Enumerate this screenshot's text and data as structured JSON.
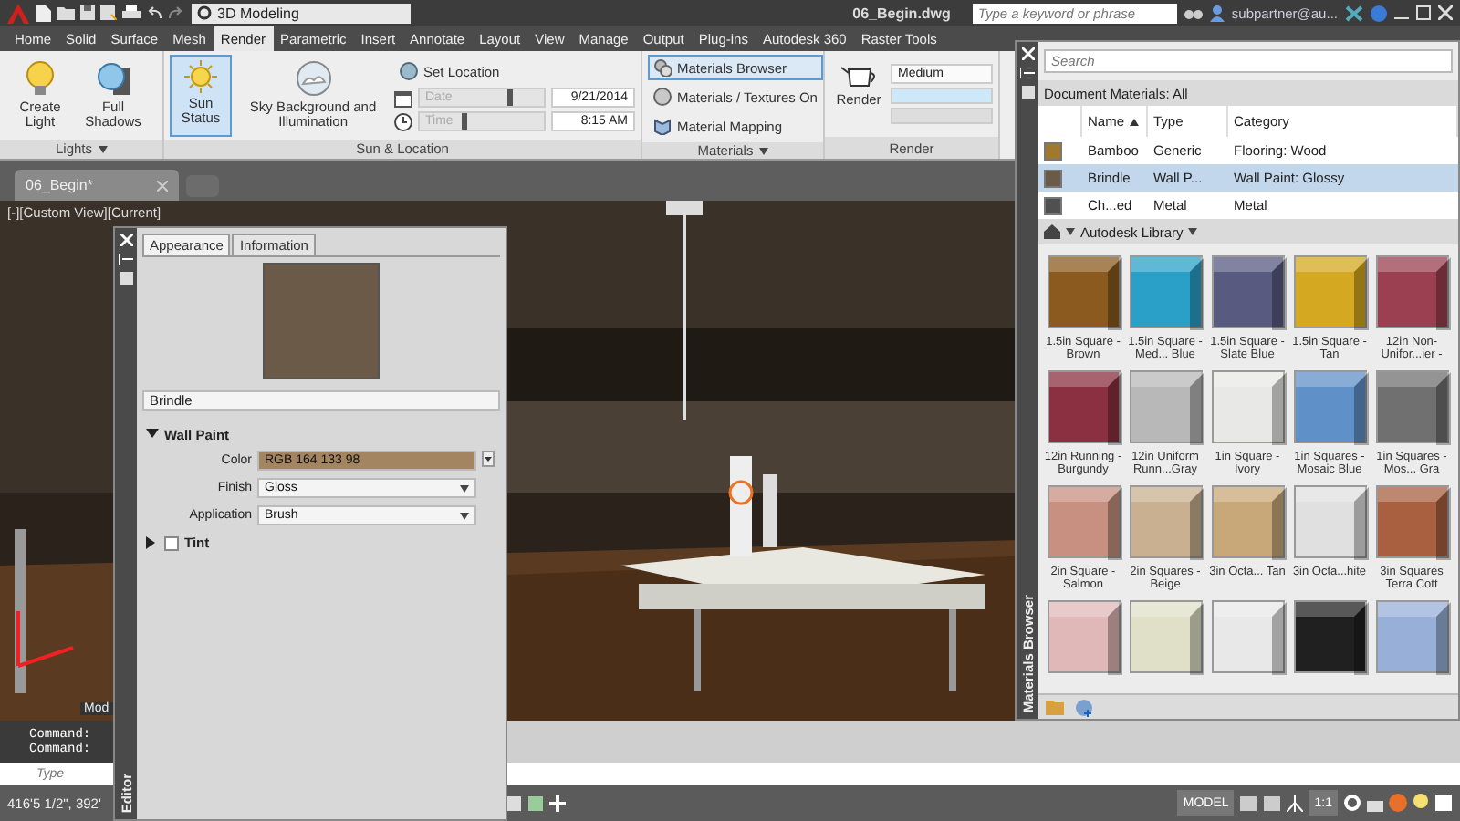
{
  "title_bar": {
    "workspace": "3D Modeling",
    "document_title": "06_Begin.dwg",
    "search": {
      "placeholder": "Type a keyword or phrase"
    },
    "user": "subpartner@au..."
  },
  "ribbon_tabs": [
    {
      "label": "Home",
      "selected": false
    },
    {
      "label": "Solid",
      "selected": false
    },
    {
      "label": "Surface",
      "selected": false
    },
    {
      "label": "Mesh",
      "selected": false
    },
    {
      "label": "Render",
      "selected": true
    },
    {
      "label": "Parametric",
      "selected": false
    },
    {
      "label": "Insert",
      "selected": false
    },
    {
      "label": "Annotate",
      "selected": false
    },
    {
      "label": "Layout",
      "selected": false
    },
    {
      "label": "View",
      "selected": false
    },
    {
      "label": "Manage",
      "selected": false
    },
    {
      "label": "Output",
      "selected": false
    },
    {
      "label": "Plug-ins",
      "selected": false
    },
    {
      "label": "Autodesk 360",
      "selected": false
    },
    {
      "label": "Raster Tools",
      "selected": false
    }
  ],
  "ribbon": {
    "lights": {
      "title": "Lights",
      "buttons": [
        {
          "label": "Create Light",
          "kind": "light"
        },
        {
          "label": "Full Shadows",
          "kind": "shadows"
        }
      ]
    },
    "sun_location": {
      "title": "Sun & Location",
      "sun_status": {
        "label": "Sun Status",
        "on": true
      },
      "sky": {
        "label": "Sky Background and Illumination"
      },
      "set_location": "Set Location",
      "sliders": [
        {
          "kind": "date",
          "label": "Date",
          "level": 0.72,
          "value": "9/21/2014"
        },
        {
          "kind": "time",
          "label": "Time",
          "level": 0.35,
          "value": "8:15 AM"
        }
      ]
    },
    "materials": {
      "title": "Materials",
      "buttons": [
        {
          "label": "Materials Browser",
          "kind": "browser",
          "on": true
        },
        {
          "label": "Materials / Textures On",
          "kind": "textures",
          "on": false
        },
        {
          "label": "Material Mapping",
          "kind": "mapping",
          "on": false
        }
      ]
    },
    "render": {
      "title": "Render",
      "button": "Render",
      "preset": "Medium"
    }
  },
  "file_tabs": [
    {
      "label": "06_Begin*",
      "selected": true
    }
  ],
  "viewport": {
    "label": "[-][Custom View][Current]",
    "layout_tab": "Mod"
  },
  "materials_editor": {
    "title": "Editor",
    "tabs": [
      {
        "label": "Appearance",
        "selected": true
      },
      {
        "label": "Information",
        "selected": false
      }
    ],
    "name": "Brindle",
    "sections": [
      {
        "title": "Wall Paint",
        "expanded": true,
        "kind": "group",
        "properties": [
          {
            "label": "Color",
            "kind": "color",
            "value": "RGB 164 133 98",
            "color": "#a48562"
          },
          {
            "label": "Finish",
            "kind": "dropdown",
            "value": "Gloss"
          },
          {
            "label": "Application",
            "kind": "dropdown",
            "value": "Brush"
          }
        ]
      },
      {
        "title": "Tint",
        "expanded": false,
        "kind": "toggle",
        "checked": false
      }
    ]
  },
  "materials_browser": {
    "title": "Materials Browser",
    "search": {
      "placeholder": "Search"
    },
    "filter": "Document Materials: All",
    "columns": [
      {
        "label": "Name",
        "sorted": true
      },
      {
        "label": "Type",
        "sorted": false
      },
      {
        "label": "Category",
        "sorted": false
      }
    ],
    "rows": [
      {
        "name": "Bamboo",
        "type": "Generic",
        "category": "Flooring: Wood",
        "color": "#a07830",
        "selected": false
      },
      {
        "name": "Brindle",
        "type": "Wall P...",
        "category": "Wall Paint: Glossy",
        "color": "#6a5a48",
        "selected": true
      },
      {
        "name": "Ch...ed",
        "type": "Metal",
        "category": "Metal",
        "color": "#505050",
        "selected": false
      }
    ],
    "library": "Autodesk Library",
    "swatches": [
      {
        "label": "1.5in Square - Brown",
        "color": "#8a5a1e"
      },
      {
        "label": "1.5in Square - Med... Blue",
        "color": "#2aa0c8"
      },
      {
        "label": "1.5in Square - Slate Blue",
        "color": "#585a80"
      },
      {
        "label": "1.5in Square - Tan",
        "color": "#d4a820"
      },
      {
        "label": "12in Non-Unifor...ier -",
        "color": "#9a4050"
      },
      {
        "label": "12in Running - Burgundy",
        "color": "#8a3040"
      },
      {
        "label": "12in Uniform Runn...Gray",
        "color": "#b8b8b8"
      },
      {
        "label": "1in Square - Ivory",
        "color": "#e8e8e6"
      },
      {
        "label": "1in Squares - Mosaic Blue",
        "color": "#6090c8"
      },
      {
        "label": "1in Squares - Mos... Gra",
        "color": "#707070"
      },
      {
        "label": "2in Square - Salmon",
        "color": "#c89080"
      },
      {
        "label": "2in Squares - Beige",
        "color": "#c8b090"
      },
      {
        "label": "3in Octa... Tan",
        "color": "#c8a878"
      },
      {
        "label": "3in Octa...hite",
        "color": "#e0e0e0"
      },
      {
        "label": "3in Squares Terra Cott",
        "color": "#a86040"
      },
      {
        "color": "#e0b8b8"
      },
      {
        "color": "#e0e0c8"
      },
      {
        "color": "#e8e8e8"
      },
      {
        "color": "#202020"
      },
      {
        "color": "#98b0d8"
      }
    ]
  },
  "command_line": {
    "history": [
      "Command:",
      "Command:"
    ],
    "input": {
      "placeholder": "Type"
    }
  },
  "status_bar": {
    "coordinates": "416'5 1/2\", 392'",
    "space": "MODEL",
    "scale": "1:1"
  }
}
